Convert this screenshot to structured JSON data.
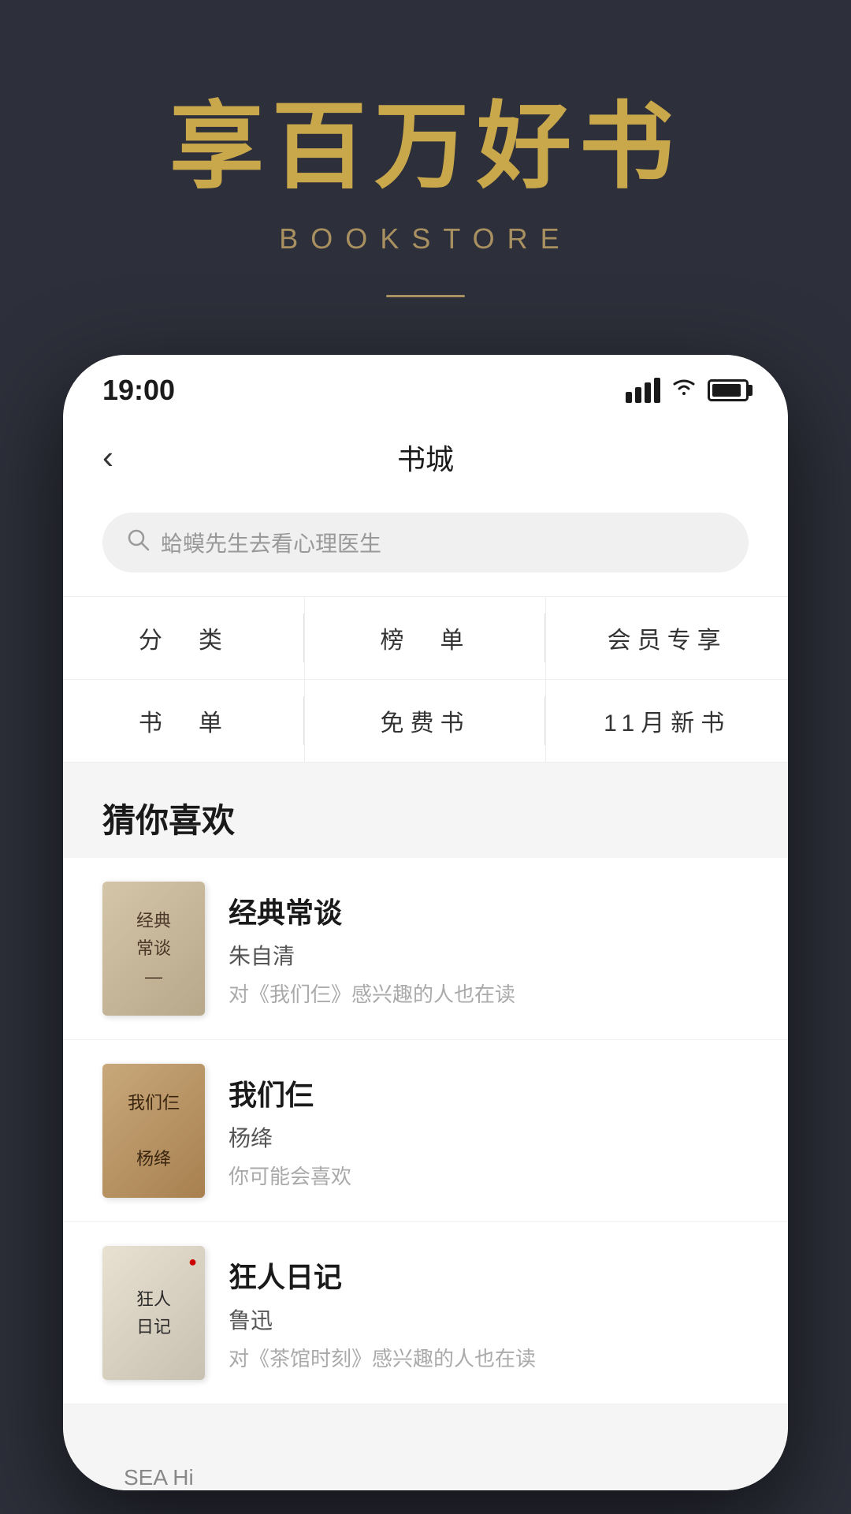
{
  "hero": {
    "title": "享百万好书",
    "subtitle": "BOOKSTORE"
  },
  "status_bar": {
    "time": "19:00"
  },
  "nav": {
    "title": "书城",
    "back_label": "‹"
  },
  "search": {
    "placeholder": "蛤蟆先生去看心理医生"
  },
  "categories": [
    {
      "label": "分　类"
    },
    {
      "label": "榜　单"
    },
    {
      "label": "会员专享"
    },
    {
      "label": "书　单"
    },
    {
      "label": "免费书"
    },
    {
      "label": "11月新书"
    }
  ],
  "recommendations": {
    "section_title": "猜你喜欢",
    "books": [
      {
        "title": "经典常谈",
        "author": "朱自清",
        "desc": "对《我们仨》感兴趣的人也在读",
        "cover_text": "经典\n常谈"
      },
      {
        "title": "我们仨",
        "author": "杨绛",
        "desc": "你可能会喜欢",
        "cover_text": "我们仨"
      },
      {
        "title": "狂人日记",
        "author": "鲁迅",
        "desc": "对《茶馆时刻》感兴趣的人也在读",
        "cover_text": "狂人日记"
      }
    ]
  },
  "bottom_hint": "SEA Hi"
}
